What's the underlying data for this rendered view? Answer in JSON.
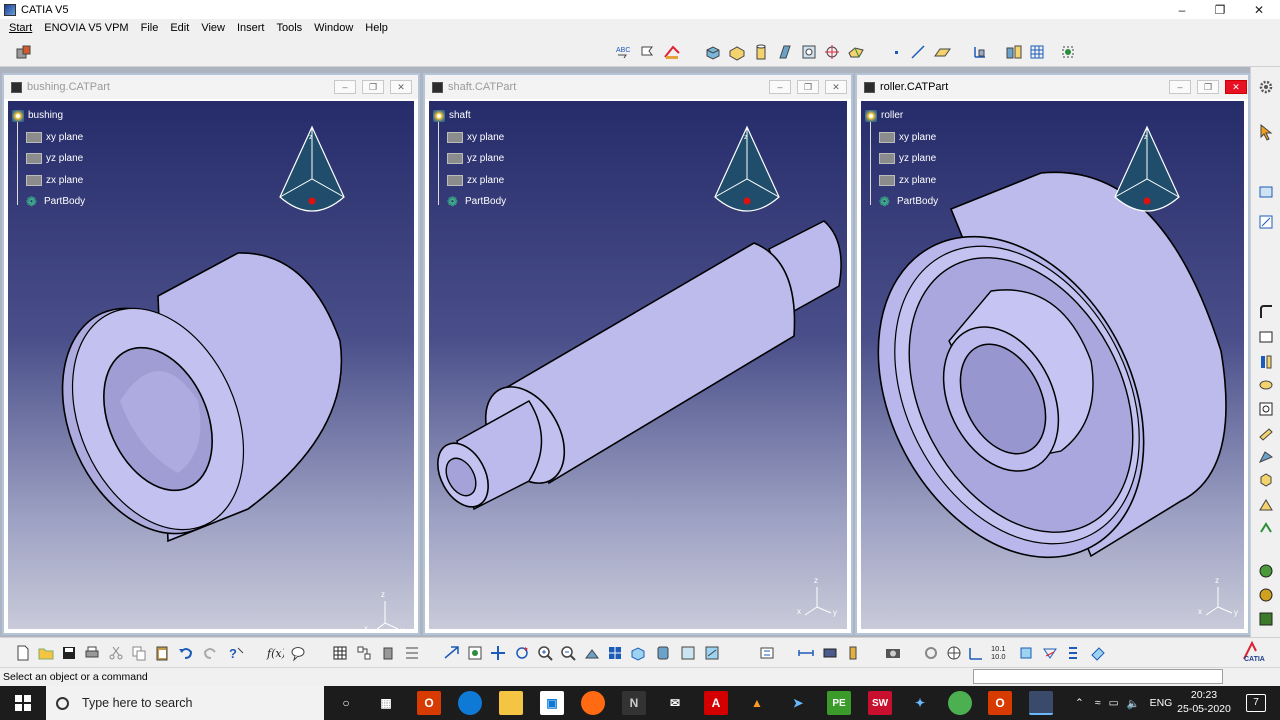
{
  "window": {
    "title": "CATIA V5"
  },
  "menu": [
    "Start",
    "ENOVIA V5 VPM",
    "File",
    "Edit",
    "View",
    "Insert",
    "Tools",
    "Window",
    "Help"
  ],
  "documents": [
    {
      "title": "bushing.CATPart",
      "root": "bushing",
      "state": "inactive"
    },
    {
      "title": "shaft.CATPart",
      "root": "shaft",
      "state": "inactive"
    },
    {
      "title": "roller.CATPart",
      "root": "roller",
      "state": "active"
    }
  ],
  "tree_items": [
    "xy plane",
    "yz plane",
    "zx plane",
    "PartBody"
  ],
  "compass_axis_label": "z",
  "axis_labels": {
    "x": "x",
    "y": "y",
    "z": "z"
  },
  "status": {
    "message": "Select an object or a command"
  },
  "toolbar_text": {
    "v_label": "10.1\n10.0"
  },
  "taskbar": {
    "search_placeholder": "Type here to search",
    "language": "ENG",
    "time": "20:23",
    "date": "25-05-2020",
    "notifications": "7"
  },
  "colors": {
    "viewport_top": "#262c6a",
    "viewport_bottom": "#c9cad9",
    "part_face": "#b7b5ea",
    "part_dark": "#8e8cc8",
    "compass": "#1f4d6b"
  }
}
